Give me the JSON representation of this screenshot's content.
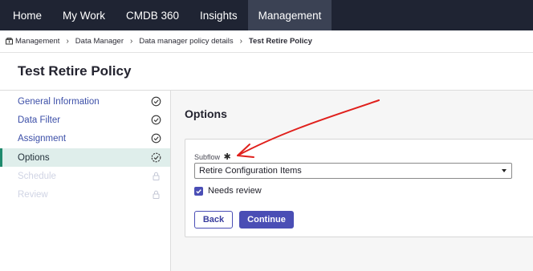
{
  "topnav": {
    "items": [
      {
        "label": "Home",
        "active": false
      },
      {
        "label": "My Work",
        "active": false
      },
      {
        "label": "CMDB 360",
        "active": false
      },
      {
        "label": "Insights",
        "active": false
      },
      {
        "label": "Management",
        "active": true
      }
    ]
  },
  "breadcrumb": {
    "items": [
      "Management",
      "Data Manager",
      "Data manager policy details",
      "Test Retire Policy"
    ]
  },
  "page": {
    "title": "Test Retire Policy"
  },
  "sidebar": {
    "items": [
      {
        "label": "General Information",
        "state": "complete"
      },
      {
        "label": "Data Filter",
        "state": "complete"
      },
      {
        "label": "Assignment",
        "state": "complete"
      },
      {
        "label": "Options",
        "state": "in-progress"
      },
      {
        "label": "Schedule",
        "state": "locked"
      },
      {
        "label": "Review",
        "state": "locked"
      }
    ]
  },
  "main": {
    "section_title": "Options",
    "subflow": {
      "label": "Subflow",
      "required_marker": "✱",
      "value": "Retire Configuration Items"
    },
    "needs_review": {
      "label": "Needs review",
      "checked": true
    },
    "buttons": {
      "back": "Back",
      "continue": "Continue"
    }
  },
  "colors": {
    "nav_bg": "#1f2433",
    "accent": "#4a4eb5",
    "active_step_bg": "#dfeeeb",
    "annotation": "#e0201c"
  }
}
